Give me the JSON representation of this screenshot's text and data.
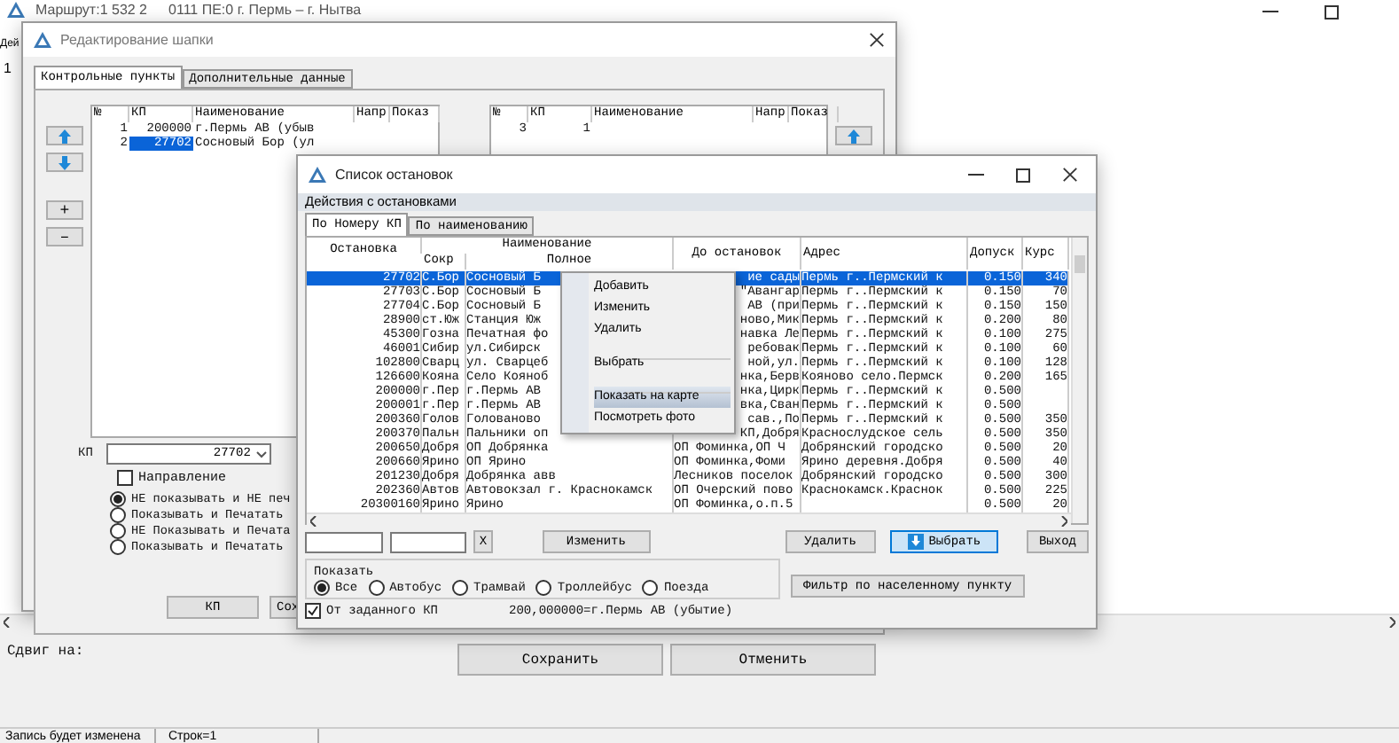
{
  "app": {
    "title": "Маршрут:1 532 2",
    "subtitle": "0111 ПЕ:0 г. Пермь – г. Нытва",
    "menu_fragment": "Дей",
    "row_marker": "1",
    "shift_label": "Сдвиг на:",
    "buttons": [
      "Сохранить",
      "Отменить"
    ],
    "status_bar": [
      "Запись будет изменена",
      "Строк=1"
    ]
  },
  "header_editor": {
    "title": "Редактирование шапки",
    "tabs": [
      {
        "label": "Контрольные пункты",
        "selected": true
      },
      {
        "label": "Дополнительные данные",
        "selected": false
      }
    ],
    "left_table": {
      "columns": [
        "№",
        "КП",
        "Наименование",
        "Напр",
        "Показ"
      ],
      "rows": [
        {
          "cells": [
            "1",
            "200000",
            "г.Пермь АВ (убыв"
          ],
          "selected": false
        },
        {
          "cells": [
            "2",
            "27702",
            "Сосновый Бор (ул"
          ],
          "selected": true
        }
      ]
    },
    "right_table": {
      "columns": [
        "№",
        "КП",
        "Наименование",
        "Напр",
        "Показ"
      ],
      "rows": [
        {
          "cells": [
            "3",
            "1"
          ],
          "selected": false
        }
      ]
    },
    "side_buttons": [
      {
        "kind": "up"
      },
      {
        "kind": "down"
      },
      {
        "kind": "add",
        "label": "+"
      },
      {
        "kind": "remove",
        "label": "–"
      }
    ],
    "right_buttons": [
      {
        "kind": "up"
      }
    ],
    "kp_label": "КП",
    "kp_value": "27702",
    "direction": {
      "label": "Направление",
      "checked": false
    },
    "display_options": [
      {
        "label": "НЕ показывать и НЕ печ",
        "selected": true
      },
      {
        "label": "Показывать и Печатать",
        "selected": false
      },
      {
        "label": "НЕ Показывать и Печата",
        "selected": false
      },
      {
        "label": "Показывать и Печатать",
        "selected": false
      }
    ],
    "buttons": [
      "КП",
      "Сох"
    ]
  },
  "stops_window": {
    "title": "Список остановок",
    "section": "Действия с остановками",
    "tabs": [
      {
        "label": "По Номеру КП",
        "selected": true
      },
      {
        "label": "По наименованию",
        "selected": false
      }
    ],
    "group_heading": "Наименование",
    "columns": [
      "Остановка",
      "Сокр",
      "Полное",
      "До остановок",
      "Адрес",
      "Допуск",
      "Курс"
    ],
    "rows": [
      {
        "cells": [
          "27702",
          "С.Бор",
          "Сосновый Б",
          "ие сады",
          "Пермь г..Пермский к",
          "0.150",
          "340"
        ],
        "selected": true
      },
      {
        "cells": [
          "27703",
          "С.Бор",
          "Сосновый Б",
          "\"Авангар",
          "Пермь г..Пермский к",
          "0.150",
          "70"
        ],
        "selected": false
      },
      {
        "cells": [
          "27704",
          "С.Бор",
          "Сосновый Б",
          "АВ (при",
          "Пермь г..Пермский к",
          "0.150",
          "150"
        ],
        "selected": false
      },
      {
        "cells": [
          "28900",
          "ст.Юж",
          "Станция Юж",
          "ново,Мик",
          "Пермь г..Пермский к",
          "0.200",
          "80"
        ],
        "selected": false
      },
      {
        "cells": [
          "45300",
          "Гозна",
          "Печатная фо",
          "навка Ле",
          "Пермь г..Пермский к",
          "0.100",
          "275"
        ],
        "selected": false
      },
      {
        "cells": [
          "46001",
          "Сибир",
          "ул.Сибирск",
          "ребовак",
          "Пермь г..Пермский к",
          "0.100",
          "60"
        ],
        "selected": false
      },
      {
        "cells": [
          "102800",
          "Сварц",
          "ул. Сварцеб",
          "ной,ул.",
          "Пермь г..Пермский к",
          "0.100",
          "128"
        ],
        "selected": false
      },
      {
        "cells": [
          "126600",
          "Кояна",
          "Село Кояноб",
          "нка,Берв",
          "Кояново село.Пермск",
          "0.200",
          "165"
        ],
        "selected": false
      },
      {
        "cells": [
          "200000",
          "г.Пер",
          "г.Пермь АВ",
          "нка,Цирк",
          "Пермь г..Пермский к",
          "0.500",
          ""
        ],
        "selected": false
      },
      {
        "cells": [
          "200001",
          "г.Пер",
          "г.Пермь АВ",
          "вка,Сван",
          "Пермь г..Пермский к",
          "0.500",
          ""
        ],
        "selected": false
      },
      {
        "cells": [
          "200360",
          "Голов",
          "Голованово",
          "сав.,По",
          "Пермь г..Пермский к",
          "0.500",
          "350"
        ],
        "selected": false
      },
      {
        "cells": [
          "200370",
          "Пальн",
          "Пальники оп",
          "КП,Добря",
          "Краснослудское сель",
          "0.500",
          "350"
        ],
        "selected": false
      },
      {
        "cells": [
          "200650",
          "Добря",
          "ОП Добрянка",
          "ОП Фоминка,ОП Ч",
          "Добрянский городско",
          "0.500",
          "20"
        ],
        "selected": false
      },
      {
        "cells": [
          "200660",
          "Ярино",
          "ОП Ярино",
          "ОП Фоминка,Фоми",
          "Ярино деревня.Добря",
          "0.500",
          "40"
        ],
        "selected": false
      },
      {
        "cells": [
          "201230",
          "Добря",
          "Добрянка авв",
          "Лесников поселок",
          "Добрянский городско",
          "0.500",
          "300"
        ],
        "selected": false
      },
      {
        "cells": [
          "202360",
          "Автов",
          "Автовокзал г. Краснокамск",
          "ОП Очерский пово",
          "Краснокамск.Краснок",
          "0.500",
          "225"
        ],
        "selected": false
      },
      {
        "cells": [
          "20300160",
          "Ярино",
          "Ярино",
          "ОП Фоминка,о.п.5",
          "",
          "0.500",
          "20"
        ],
        "selected": false
      }
    ],
    "context_menu": [
      {
        "label": "Добавить",
        "selected": false,
        "separator_before": false
      },
      {
        "label": "Изменить",
        "selected": false,
        "separator_before": false
      },
      {
        "label": "Удалить",
        "selected": false,
        "separator_before": false
      },
      {
        "label": "Выбрать",
        "selected": false,
        "separator_before": true
      },
      {
        "label": "Показать на карте",
        "selected": true,
        "separator_before": true
      },
      {
        "label": "Посмотреть фото",
        "selected": false,
        "separator_before": false
      }
    ],
    "clear_button": "X",
    "actions": [
      {
        "label": "Изменить",
        "focused": false
      },
      {
        "label": "Удалить",
        "focused": false
      },
      {
        "label": "Выбрать",
        "focused": true
      },
      {
        "label": "Выход",
        "focused": false
      }
    ],
    "show_heading": "Показать",
    "transport": [
      {
        "label": "Все",
        "selected": true
      },
      {
        "label": "Автобус",
        "selected": false
      },
      {
        "label": "Трамвай",
        "selected": false
      },
      {
        "label": "Троллейбус",
        "selected": false
      },
      {
        "label": "Поезда",
        "selected": false
      }
    ],
    "filter_button": "Фильтр по населенному пункту",
    "from_kp": {
      "label": "От заданного КП",
      "checked": true
    },
    "from_kp_value": "200,000000=г.Пермь АВ (убытие)"
  }
}
